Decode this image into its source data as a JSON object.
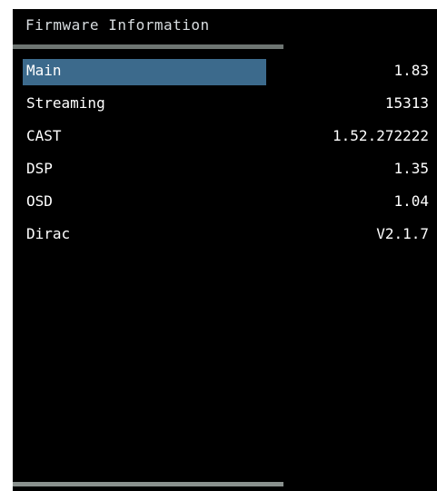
{
  "screen": {
    "title": "Firmware Information",
    "selected_index": 0,
    "colors": {
      "background": "#000000",
      "text": "#ffffff",
      "selection": "#3c6a8c",
      "rule": "#6e7572"
    }
  },
  "firmware": {
    "items": [
      {
        "label": "Main",
        "value": "1.83"
      },
      {
        "label": "Streaming",
        "value": "15313"
      },
      {
        "label": "CAST",
        "value": "1.52.272222"
      },
      {
        "label": "DSP",
        "value": "1.35"
      },
      {
        "label": "OSD",
        "value": "1.04"
      },
      {
        "label": "Dirac",
        "value": "V2.1.7"
      }
    ]
  }
}
